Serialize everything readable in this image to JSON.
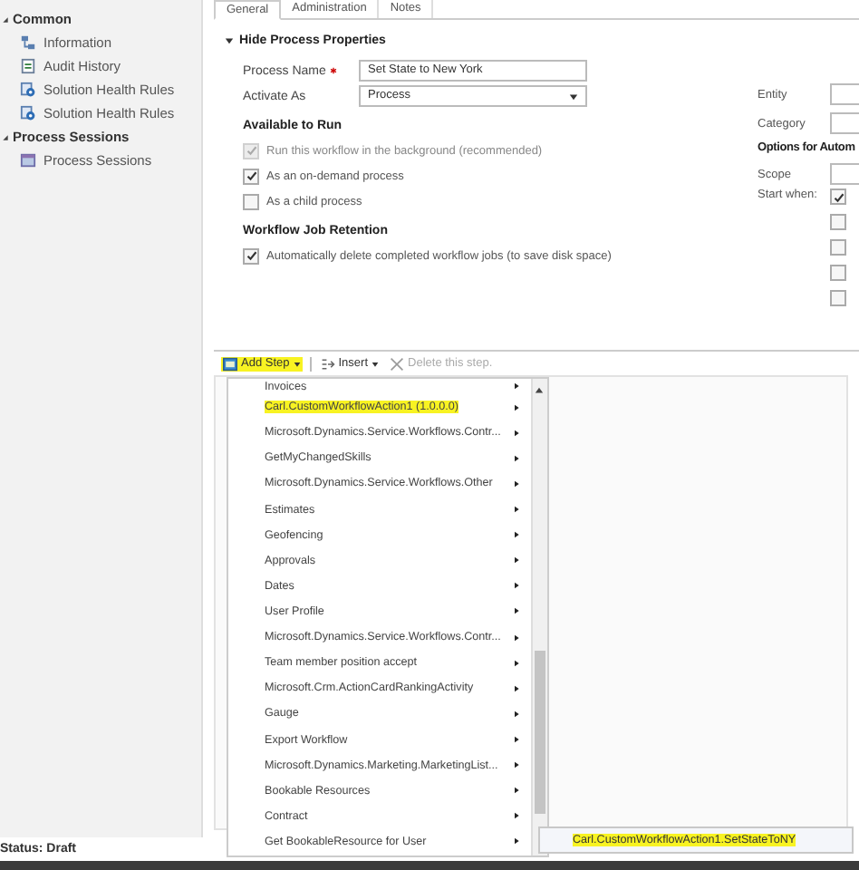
{
  "sidebar": {
    "groups": [
      {
        "title": "Common",
        "expanded": true,
        "items": [
          {
            "label": "Information"
          },
          {
            "label": "Audit History"
          },
          {
            "label": "Solution Health Rules"
          },
          {
            "label": "Solution Health Rules"
          }
        ]
      },
      {
        "title": "Process Sessions",
        "expanded": true,
        "items": [
          {
            "label": "Process Sessions"
          }
        ]
      }
    ]
  },
  "tabs": [
    {
      "label": "General",
      "selected": true
    },
    {
      "label": "Administration",
      "selected": false
    },
    {
      "label": "Notes",
      "selected": false
    }
  ],
  "section": {
    "title": "Hide Process Properties",
    "expanded": true
  },
  "fields": [
    {
      "label": "Process Name",
      "required": true,
      "kind": "text",
      "value": "Set State to New York"
    },
    {
      "label": "Activate As",
      "required": false,
      "kind": "select",
      "value": "Process"
    }
  ],
  "available_to_run": {
    "title": "Available to Run",
    "options": [
      {
        "label": "Run this workflow in the background (recommended)",
        "checked": true,
        "disabled": true
      },
      {
        "label": "As an on-demand process",
        "checked": true,
        "disabled": false
      },
      {
        "label": "As a child process",
        "checked": false,
        "disabled": false
      }
    ]
  },
  "retention": {
    "title": "Workflow Job Retention",
    "options": [
      {
        "label": "Automatically delete completed workflow jobs (to save disk space)",
        "checked": true,
        "disabled": false
      }
    ]
  },
  "right_panel": {
    "fields": [
      {
        "label": "Entity"
      },
      {
        "label": "Category"
      }
    ],
    "options_title": "Options for Autom",
    "scope_label": "Scope",
    "start_label": "Start when:",
    "start_options": [
      {
        "checked": true
      },
      {
        "checked": false
      },
      {
        "checked": false
      },
      {
        "checked": false
      },
      {
        "checked": false
      }
    ]
  },
  "toolbar": [
    {
      "label": "Add Step",
      "kind": "add",
      "highlighted": true,
      "disabled": false
    },
    {
      "label": "Insert",
      "kind": "insert",
      "highlighted": false,
      "disabled": false
    },
    {
      "label": "Delete this step.",
      "kind": "delete",
      "highlighted": false,
      "disabled": true
    }
  ],
  "menu": {
    "items": [
      {
        "label": "Invoices",
        "highlighted": false
      },
      {
        "label": "Carl.CustomWorkflowAction1 (1.0.0.0)",
        "highlighted": true
      },
      {
        "label": "Microsoft.Dynamics.Service.Workflows.Contr...",
        "highlighted": false
      },
      {
        "label": "GetMyChangedSkills",
        "highlighted": false
      },
      {
        "label": "Microsoft.Dynamics.Service.Workflows.Other",
        "highlighted": false
      },
      {
        "label": "Estimates",
        "highlighted": false
      },
      {
        "label": "Geofencing",
        "highlighted": false
      },
      {
        "label": "Approvals",
        "highlighted": false
      },
      {
        "label": "Dates",
        "highlighted": false
      },
      {
        "label": "User Profile",
        "highlighted": false
      },
      {
        "label": "Microsoft.Dynamics.Service.Workflows.Contr...",
        "highlighted": false
      },
      {
        "label": "Team member position accept",
        "highlighted": false
      },
      {
        "label": "Microsoft.Crm.ActionCardRankingActivity",
        "highlighted": false
      },
      {
        "label": "Gauge",
        "highlighted": false
      },
      {
        "label": "Export Workflow",
        "highlighted": false
      },
      {
        "label": "Microsoft.Dynamics.Marketing.MarketingList...",
        "highlighted": false
      },
      {
        "label": "Bookable Resources",
        "highlighted": false
      },
      {
        "label": "Contract",
        "highlighted": false
      },
      {
        "label": "Get BookableResource for User",
        "highlighted": false
      }
    ]
  },
  "submenu": {
    "items": [
      {
        "label": "Carl.CustomWorkflowAction1.SetStateToNY",
        "highlighted": true
      }
    ]
  },
  "status_bar": {
    "text": "Status: Draft"
  }
}
